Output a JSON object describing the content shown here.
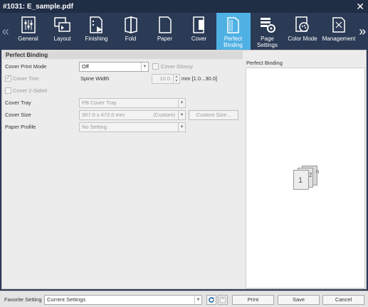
{
  "window": {
    "title": "#1031: E_sample.pdf"
  },
  "toolbar": {
    "tabs": [
      {
        "label": "General",
        "icon": "general-icon"
      },
      {
        "label": "Layout",
        "icon": "layout-icon"
      },
      {
        "label": "Finishing",
        "icon": "finishing-icon"
      },
      {
        "label": "Fold",
        "icon": "fold-icon"
      },
      {
        "label": "Paper",
        "icon": "paper-icon"
      },
      {
        "label": "Cover",
        "icon": "cover-icon"
      },
      {
        "label": "Perfect Binding",
        "icon": "perfect-binding-icon",
        "active": true
      },
      {
        "label": "Page Settings",
        "icon": "page-settings-icon"
      },
      {
        "label": "Color Mode",
        "icon": "color-mode-icon"
      },
      {
        "label": "Management",
        "icon": "management-icon"
      }
    ],
    "prev_label": "«",
    "next_label": "»"
  },
  "section": {
    "title": "Perfect Binding"
  },
  "form": {
    "cover_print_mode": {
      "label": "Cover Print Mode",
      "value": "Off"
    },
    "cover_glossy": {
      "label": "Cover Glossy",
      "checked": false
    },
    "cover_trim": {
      "label": "Cover Trim",
      "checked": true
    },
    "spine_width": {
      "label": "Spine Width",
      "value": "10.0",
      "unit": "mm [1.0...30.0]"
    },
    "cover_2sided": {
      "label": "Cover 2-Sided",
      "checked": false
    },
    "cover_tray": {
      "label": "Cover Tray",
      "value": "PB Cover Tray"
    },
    "cover_size": {
      "label": "Cover Size",
      "value": "307.0 x 472.0 mm",
      "suffix": "(Custom)",
      "button": "Custom Size..."
    },
    "paper_profile": {
      "label": "Paper Profile",
      "value": "No Setting"
    }
  },
  "preview": {
    "title": "Perfect Binding",
    "page1": "1",
    "page2": "2",
    "pagen": "n"
  },
  "footer": {
    "favorite_label": "Favorite Setting",
    "favorite_value": "Current Settings",
    "print_label": "Print",
    "save_label": "Save",
    "cancel_label": "Cancel"
  },
  "colors": {
    "accent": "#4fb0e3",
    "toolbar_bg": "#2b3a55",
    "titlebar_bg": "#1f2d45"
  }
}
